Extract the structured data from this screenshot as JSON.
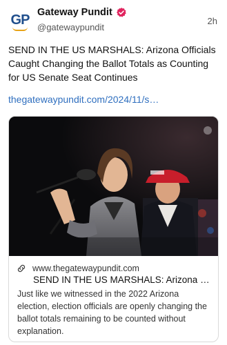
{
  "post": {
    "author": {
      "logo_text": "GP",
      "display_name": "Gateway Pundit",
      "handle": "@gatewaypundit",
      "verified_icon": "verified-badge-icon"
    },
    "timestamp": "2h",
    "text": "SEND IN THE US MARSHALS: Arizona Officials Caught Changing the Ballot Totals as Counting for US Senate Seat Continues",
    "link_text": "thegatewaypundit.com/2024/11/s…"
  },
  "card": {
    "image_icon": "news-photo",
    "link_icon": "link-icon",
    "domain": "www.thegatewaypundit.com",
    "title": "SEND IN THE US MARSHALS: Arizona Officials Caught Changing the Ballot Totals as Counting for US Senate Seat Continues",
    "description": "Just like we witnessed in the 2022 Arizona election, election officials are openly changing the ballot totals remaining to be counted without explanation."
  },
  "colors": {
    "brand_blue": "#1f4e8c",
    "brand_gold": "#e8a317",
    "verified": "#e0245e",
    "link": "#2f6fbf"
  }
}
